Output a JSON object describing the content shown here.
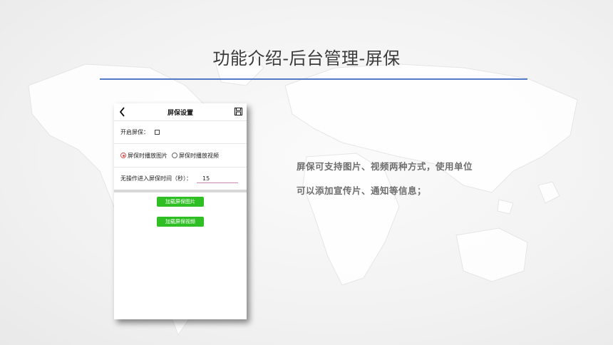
{
  "slide": {
    "title": "功能介绍-后台管理-屏保",
    "description_lines": [
      "屏保可支持图片、视频两种方式，使用单位",
      "可以添加宣传片、通知等信息；"
    ]
  },
  "phone": {
    "header_title": "屏保设置",
    "enable_label": "开启屏保：",
    "enable_checked": false,
    "radio_options": [
      {
        "label": "屏保时播放图片",
        "selected": true
      },
      {
        "label": "屏保时播放视频",
        "selected": false
      }
    ],
    "idle_label": "无操作进入屏保时间（秒）：",
    "idle_value": "15",
    "load_image_button": "加载屏保图片",
    "load_video_button": "加载屏保视频"
  },
  "colors": {
    "accent_rule": "#5479c6",
    "button_green": "#2fbf24",
    "radio_selected": "#d9534f"
  },
  "icons": [
    "back-arrow-icon",
    "save-icon",
    "world-map-background"
  ]
}
